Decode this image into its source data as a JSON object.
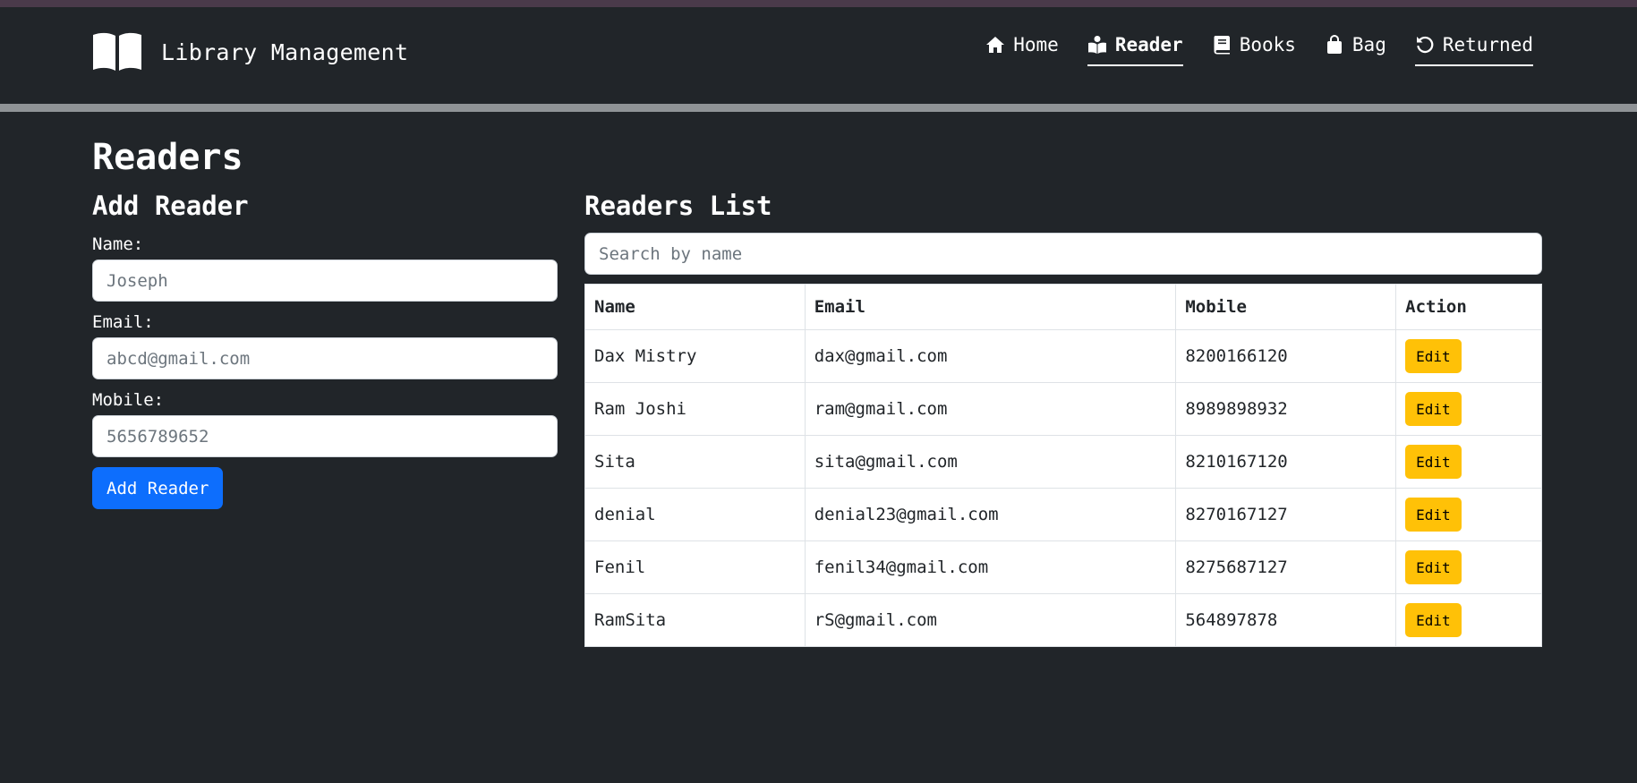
{
  "app": {
    "title": "Library Management",
    "brand_icon": "open-book-icon"
  },
  "nav": {
    "items": [
      {
        "label": "Home",
        "icon": "home-icon"
      },
      {
        "label": "Reader",
        "icon": "reader-icon",
        "active": true
      },
      {
        "label": "Books",
        "icon": "book-icon"
      },
      {
        "label": "Bag",
        "icon": "bag-icon"
      },
      {
        "label": "Returned",
        "icon": "undo-icon"
      }
    ]
  },
  "page": {
    "title": "Readers"
  },
  "form": {
    "title": "Add Reader",
    "name_label": "Name:",
    "name_placeholder": "Joseph",
    "email_label": "Email:",
    "email_placeholder": "abcd@gmail.com",
    "mobile_label": "Mobile:",
    "mobile_placeholder": "5656789652",
    "submit_label": "Add Reader"
  },
  "list": {
    "title": "Readers List",
    "search_placeholder": "Search by name",
    "columns": [
      "Name",
      "Email",
      "Mobile",
      "Action"
    ],
    "edit_label": "Edit",
    "rows": [
      {
        "name": "Dax Mistry",
        "email": "dax@gmail.com",
        "mobile": "8200166120"
      },
      {
        "name": "Ram Joshi",
        "email": "ram@gmail.com",
        "mobile": "8989898932"
      },
      {
        "name": "Sita",
        "email": "sita@gmail.com",
        "mobile": "8210167120"
      },
      {
        "name": "denial",
        "email": "denial23@gmail.com",
        "mobile": "8270167127"
      },
      {
        "name": "Fenil",
        "email": "fenil34@gmail.com",
        "mobile": "8275687127"
      },
      {
        "name": "RamSita",
        "email": "rS@gmail.com",
        "mobile": "564897878"
      }
    ]
  },
  "colors": {
    "background": "#212529",
    "primary": "#0d6efd",
    "warning": "#ffc107",
    "separator": "#8f9396",
    "top_strip": "#4a3a4a"
  }
}
